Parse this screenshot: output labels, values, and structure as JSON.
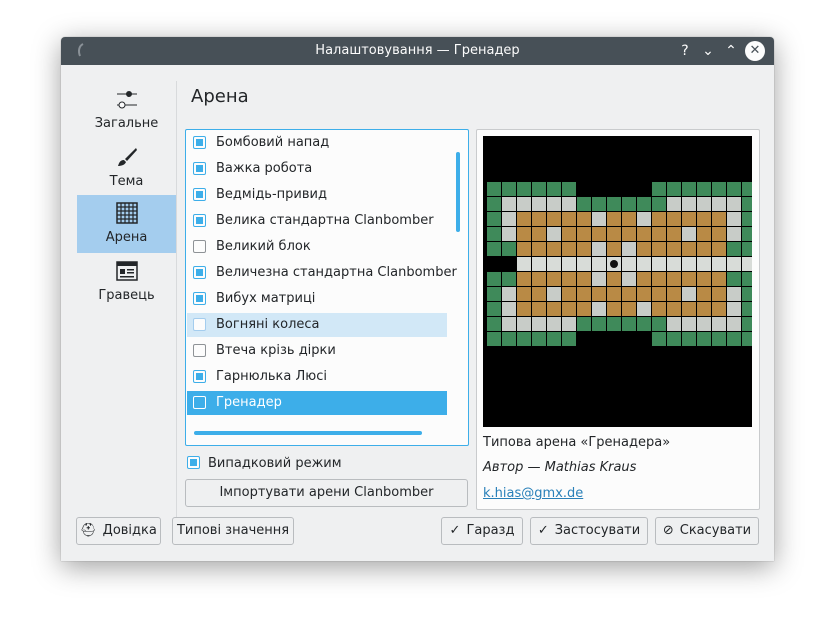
{
  "window": {
    "title": "Налаштовування — Гренадер"
  },
  "titlebar": {
    "help_glyph": "?",
    "minimize_glyph": "⌄",
    "maximize_glyph": "⌃",
    "close_glyph": "✕"
  },
  "sidebar": {
    "items": [
      {
        "label": "Загальне",
        "icon": "sliders-icon"
      },
      {
        "label": "Тема",
        "icon": "brush-icon"
      },
      {
        "label": "Арена",
        "icon": "grid-icon",
        "selected": true
      },
      {
        "label": "Гравець",
        "icon": "player-icon"
      }
    ]
  },
  "page": {
    "title": "Арена"
  },
  "arenas": [
    {
      "label": "Бомбовий напад",
      "checked": true
    },
    {
      "label": "Важка робота",
      "checked": true
    },
    {
      "label": "Ведмідь-привид",
      "checked": true
    },
    {
      "label": "Велика стандартна Clanbomber",
      "checked": true
    },
    {
      "label": "Великий блок",
      "checked": false
    },
    {
      "label": "Величезна стандартна Clanbomber",
      "checked": true
    },
    {
      "label": "Вибух матриці",
      "checked": true
    },
    {
      "label": "Вогняні колеса",
      "checked": false,
      "hover": true
    },
    {
      "label": "Втеча крізь дірки",
      "checked": false
    },
    {
      "label": "Гарнюлька Люсі",
      "checked": true
    },
    {
      "label": "Гренадер",
      "checked": false,
      "selected": true
    }
  ],
  "random_mode": {
    "label": "Випадковий режим",
    "checked": true
  },
  "import_button": "Імпортувати арени Clanbomber",
  "preview": {
    "description": "Типова арена «Гренадера»",
    "author": "Автор — Mathias Kraus",
    "email": "k.hias@gmx.de"
  },
  "buttons": {
    "help": "Довідка",
    "defaults": "Типові значення",
    "ok": "Гаразд",
    "apply": "Застосувати",
    "cancel": "Скасувати",
    "help_icon": "lifebuoy-icon",
    "ok_icon": "check-icon",
    "apply_icon": "check-icon",
    "cancel_icon": "cancel-icon"
  },
  "colors": {
    "accent": "#3daee9",
    "titlebar": "#475057",
    "selection": "#a4cdee"
  }
}
